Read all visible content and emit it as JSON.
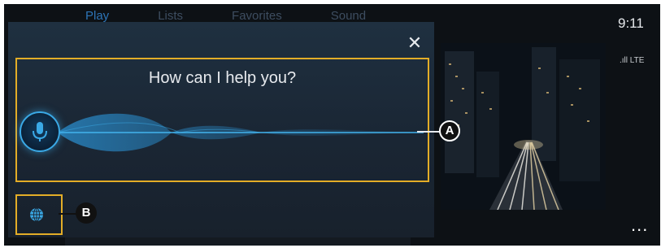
{
  "background_app": {
    "tabs": [
      "Play",
      "Lists",
      "Favorites",
      "Sound"
    ],
    "status": {
      "time": "9:11",
      "network": "LTE"
    },
    "more_label": "..."
  },
  "voice_assistant": {
    "prompt": "How can I help you?",
    "close_label": "✕",
    "mic_icon": "microphone-icon",
    "globe_icon": "globe-icon"
  },
  "callouts": {
    "a": "A",
    "b": "B"
  },
  "colors": {
    "highlight_frame": "#e3ad27",
    "accent_blue": "#3aa9e6",
    "panel_bg": "#1c2a38"
  }
}
